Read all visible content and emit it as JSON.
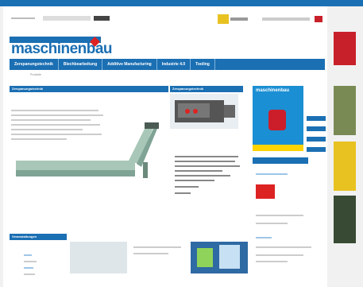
{
  "top_bar": {
    "text": ""
  },
  "logo": {
    "text": "maschinenbau"
  },
  "nav": {
    "items": [
      "Zerspanungstechnik",
      "Blechbearbeitung",
      "Additive Manufacturing",
      "Industrie 4.0",
      "Tooling"
    ]
  },
  "breadcrumb": {
    "items": [
      "",
      "",
      "",
      "",
      "Produkte",
      ""
    ]
  },
  "breadcrumb_right": "",
  "main": {
    "section_title": "Zerspanungstechnik",
    "article_title": ""
  },
  "middle": {
    "section_title": "Zerspanungstechnik",
    "caption": ""
  },
  "magazine": {
    "title": "maschinenbau"
  },
  "side_buttons": [
    "",
    "",
    "",
    ""
  ],
  "right_column": {
    "section_title": "",
    "red_logo_text": "",
    "label_1": ""
  },
  "bottom": {
    "section_title": "Veranstaltungen"
  },
  "ads": {
    "sky_text": ""
  },
  "colors": {
    "brand_blue": "#1b6fb3",
    "accent_red": "#d22"
  }
}
